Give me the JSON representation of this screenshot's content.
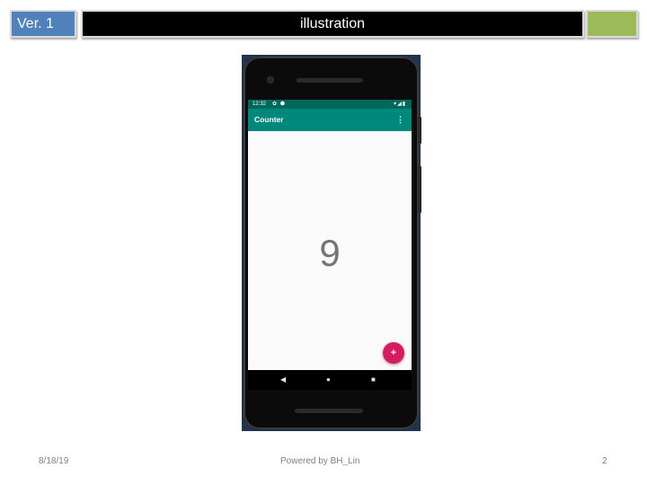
{
  "slide": {
    "version_label": "Ver. 1",
    "title": "illustration"
  },
  "phone": {
    "status_time": "12:32",
    "status_left_icons": "✿ ⬢",
    "status_right_icons": "▾◢▮",
    "app_title": "Counter",
    "overflow_icon": "⋮",
    "counter_value": "9",
    "fab_icon": "+",
    "nav_back": "◀",
    "nav_home": "●",
    "nav_recent": "■",
    "colors": {
      "status_bar": "#00695c",
      "app_bar": "#00897b",
      "fab": "#d81b60",
      "counter_text": "#757575"
    }
  },
  "footer": {
    "date": "8/18/19",
    "credit": "Powered by BH_Lin",
    "page_number": "2"
  },
  "theme": {
    "version_box": "#4f81bd",
    "title_bar": "#000000",
    "accent_box": "#9bbb59"
  }
}
